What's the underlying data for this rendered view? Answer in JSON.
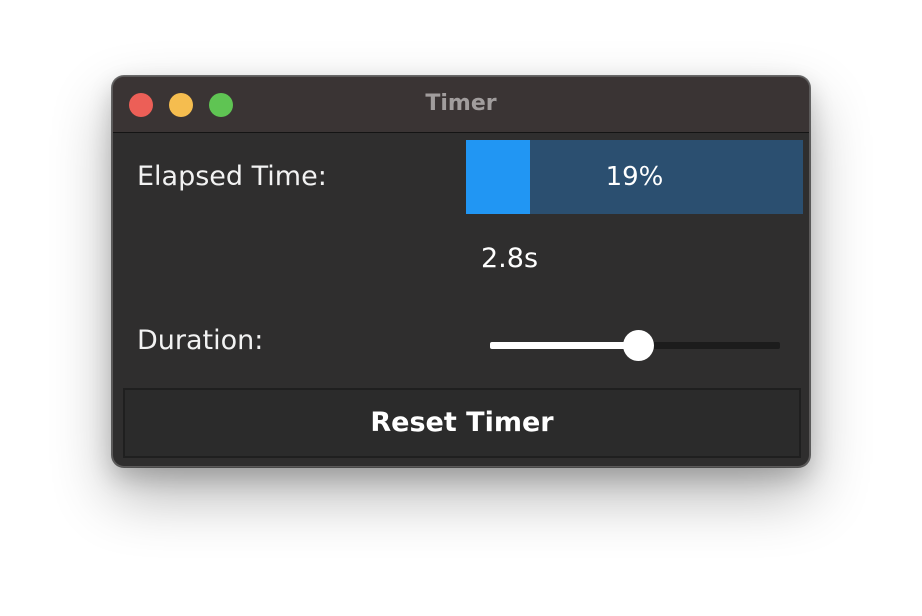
{
  "window": {
    "title": "Timer"
  },
  "elapsed": {
    "label": "Elapsed Time:",
    "progress_fraction": 0.19,
    "progress_text": "19%",
    "value_text": "2.8s"
  },
  "duration": {
    "label": "Duration:",
    "slider_fraction": 0.51
  },
  "actions": {
    "reset_label": "Reset Timer"
  },
  "colors": {
    "window_bg": "#2f2e2e",
    "titlebar_bg": "#3a3434",
    "progress_track": "#2b4f70",
    "progress_fill": "#2196f3",
    "traffic_close": "#ec5f57",
    "traffic_minimize": "#f5bd4f",
    "traffic_zoom": "#5fc453"
  }
}
